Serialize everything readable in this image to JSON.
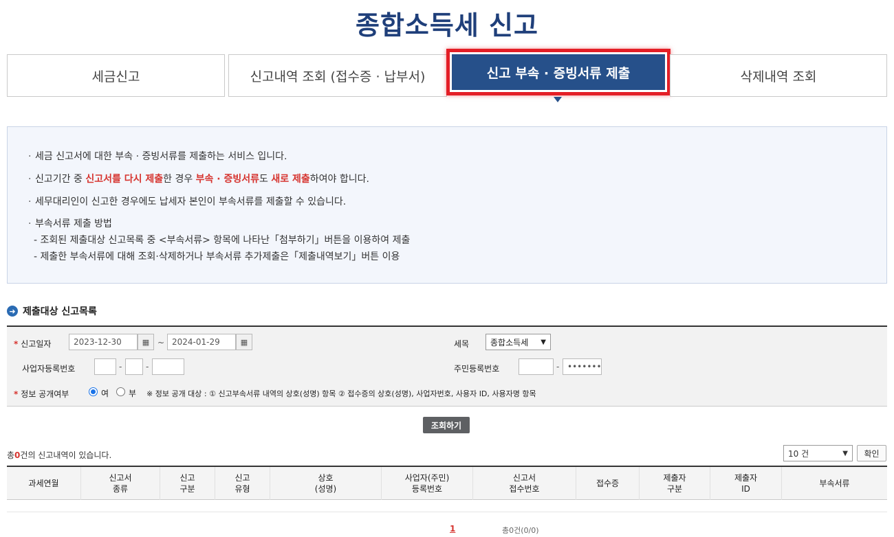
{
  "page_title": "종합소득세 신고",
  "tabs": [
    {
      "label": "세금신고"
    },
    {
      "label": "신고내역 조회 (접수증 · 납부서)"
    },
    {
      "label": "신고 부속 · 증빙서류 제출",
      "active": true
    },
    {
      "label": "삭제내역 조회"
    }
  ],
  "info": {
    "line1": "세금 신고서에 대한 부속 · 증빙서류를 제출하는 서비스 입니다.",
    "line2": {
      "p1": "신고기간 중 ",
      "r1": "신고서를 다시 제출",
      "p2": "한 경우 ",
      "r2": "부속 · 증빙서류",
      "p3": "도 ",
      "r3": "새로 제출",
      "p4": "하여야 합니다."
    },
    "line3": "세무대리인이 신고한 경우에도 납세자 본인이 부속서류를 제출할 수 있습니다.",
    "line4": "부속서류 제출 방법",
    "sub1": "- 조회된 제출대상 신고목록 중 <부속서류> 항목에 나타난「첨부하기」버튼을 이용하여 제출",
    "sub2": "- 제출한 부속서류에 대해 조회·삭제하거나 부속서류 추가제출은「제출내역보기」버튼 이용",
    "bullet": "·"
  },
  "section_title": "제출대상 신고목록",
  "search": {
    "report_date_label": "신고일자",
    "date_from": "2023-12-30",
    "date_tilde": "~",
    "date_to": "2024-01-29",
    "tax_item_label": "세목",
    "tax_item_value": "종합소득세",
    "biz_no_label": "사업자등록번호",
    "resident_no_label": "주민등록번호",
    "resident_no_back": "•••••••",
    "public_label": "정보 공개여부",
    "radio_yes": "여",
    "radio_no": "부",
    "public_note": "※ 정보 공개 대상 : ① 신고부속서류 내역의 상호(성명) 항목 ② 접수증의 상호(성명), 사업자번호, 사용자 ID, 사용자명 항목",
    "required_mark": "*",
    "dash": "-"
  },
  "search_button": "조회하기",
  "result": {
    "prefix": "총",
    "count": "0",
    "suffix": "건의 신고내역이 있습니다."
  },
  "page_size": "10 건",
  "confirm_button": "확인",
  "table": {
    "headers": [
      "과세연월",
      "신고서\n종류",
      "신고\n구분",
      "신고\n유형",
      "상호\n(성명)",
      "사업자(주민)\n등록번호",
      "신고서\n접수번호",
      "접수증",
      "제출자\n구분",
      "제출자\nID",
      "부속서류"
    ]
  },
  "pagination": {
    "current": "1",
    "total": "총0건(0/0)"
  }
}
